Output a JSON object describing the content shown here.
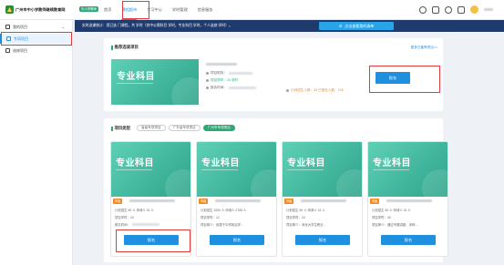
{
  "header": {
    "brand": "广州市中小学教师继续教育网",
    "brand_badge": "中小学教师",
    "nav": [
      "首页",
      "课程超市",
      "学习中心",
      "学时管理",
      "信息服务"
    ],
    "nav_active_index": 1
  },
  "sidebar": {
    "items": [
      {
        "label": "我的项目",
        "icon": "grid-icon",
        "expandable": true
      },
      {
        "label": "专项项目",
        "icon": "folder-icon",
        "active": true
      },
      {
        "label": "选修项目",
        "icon": "book-icon"
      }
    ]
  },
  "notice": {
    "text": "实时选课统计：您已选 门课程，共 学时（其中公需科目 学时，专业科目 学时，个人选修 学时）。",
    "button_label": "点击查看我的清单"
  },
  "recommend": {
    "title": "推荐选读项目",
    "more_link": "更多已推荐项目>>",
    "banner_title": "专业科目",
    "info_labels": [
      "项目机构：",
      "项目学时：24 学时",
      "报名时间："
    ],
    "right_stats": "计划招生人数：40   已报名人数：106",
    "enroll_button": "报名"
  },
  "projects": {
    "title": "项目类型",
    "tabs": [
      "省级专项项目",
      "广东省专项项目",
      "广州市专项项目"
    ],
    "active_tab": 2,
    "cards": [
      {
        "banner_title": "专业科目",
        "tag": "市级",
        "row1": "计划招生 50 人  申请人 31 人",
        "row2": "项目学时：24",
        "row3": "报名时间：",
        "button": "报名"
      },
      {
        "banner_title": "专业科目",
        "tag": "市级",
        "row1": "计划招生 1000 人  申请人 2765 人",
        "row2": "项目学时：12",
        "row3": "项目简介：依靠于中学政治学…",
        "button": "报名"
      },
      {
        "banner_title": "专业科目",
        "tag": "市级",
        "row1": "计划招生 50 人  申请人 31 人",
        "row2": "项目学时：24",
        "row3": "项目简介：深化大学生职业…",
        "button": "报名"
      },
      {
        "banner_title": "专业科目",
        "tag": "市级",
        "row1": "计划招生 60 人  申请人 31 人",
        "row2": "项目学时：40",
        "row3": "项目简介：通过专题讲座、训练…",
        "button": "报名"
      }
    ]
  },
  "colors": {
    "accent": "#1f8fe0",
    "green": "#2aa876",
    "highlight": "#e23b3b"
  }
}
